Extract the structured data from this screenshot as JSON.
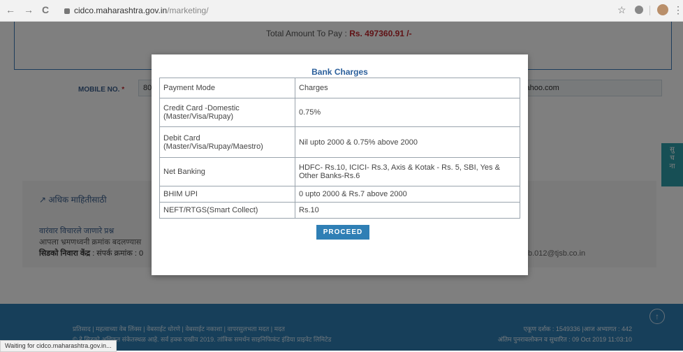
{
  "browser": {
    "back": "←",
    "forward": "→",
    "reload": "C",
    "url_host": "cidco.maharashtra.gov.in",
    "url_path": "/marketing/",
    "status_text": "Waiting for cidco.maharashtra.gov.in..."
  },
  "page": {
    "total_label": "Total Amount To Pay : ",
    "total_value": "Rs. 497360.91 /-",
    "mobile_label": "MOBILE NO.",
    "required_mark": "*",
    "mobile_value": "80",
    "email_value": "yahoo.com",
    "side_tab": "सु\nच\nना",
    "more_info": "अधिक माहितीसाठी",
    "faq": "वारंवार विचारले जाणारे प्रश्न",
    "note": "आपला भ्रमणध्वनी क्रमांक बदलण्यास",
    "help_label": "सिडको निवारा केंद्र",
    "help_value": " : संपर्क क्रमांक : 0",
    "email2": "b.012@tjsb.co.in",
    "footer_links": "प्रतिसाद | महत्वाच्या वेब लिंक्स | वेबसाईट धोरणे | वेबसाईट नकाशा | वापरसुलभता मदत | मदत",
    "footer_copy": "© हे सिडको अधिकृत संकेतस्थळ आहे. सर्व हक्क राखीव 2019. तांत्रिक समर्थन साइनिफिकंट इंडिया प्राइवेट लिमिटेड",
    "visits": "एकूण दर्शक : 1549336 |आज अभ्यागत : 442",
    "updated": "अंतिम पुनरावलोकन व सुधारित : 09 Oct 2019 11:03:10"
  },
  "modal": {
    "title": "Bank Charges",
    "header": {
      "mode": "Payment Mode",
      "charges": "Charges"
    },
    "rows": [
      {
        "mode": "Credit Card -Domestic (Master/Visa/Rupay)",
        "charges": "0.75%"
      },
      {
        "mode": "Debit Card (Master/Visa/Rupay/Maestro)",
        "charges": "Nil upto 2000 & 0.75% above 2000"
      },
      {
        "mode": "Net Banking",
        "charges": "HDFC- Rs.10, ICICI- Rs.3, Axis & Kotak - Rs. 5, SBI, Yes & Other Banks-Rs.6"
      },
      {
        "mode": "BHIM UPI",
        "charges": "0 upto 2000 & Rs.7 above 2000"
      },
      {
        "mode": "NEFT/RTGS(Smart Collect)",
        "charges": "Rs.10"
      }
    ],
    "proceed": "PROCEED"
  }
}
